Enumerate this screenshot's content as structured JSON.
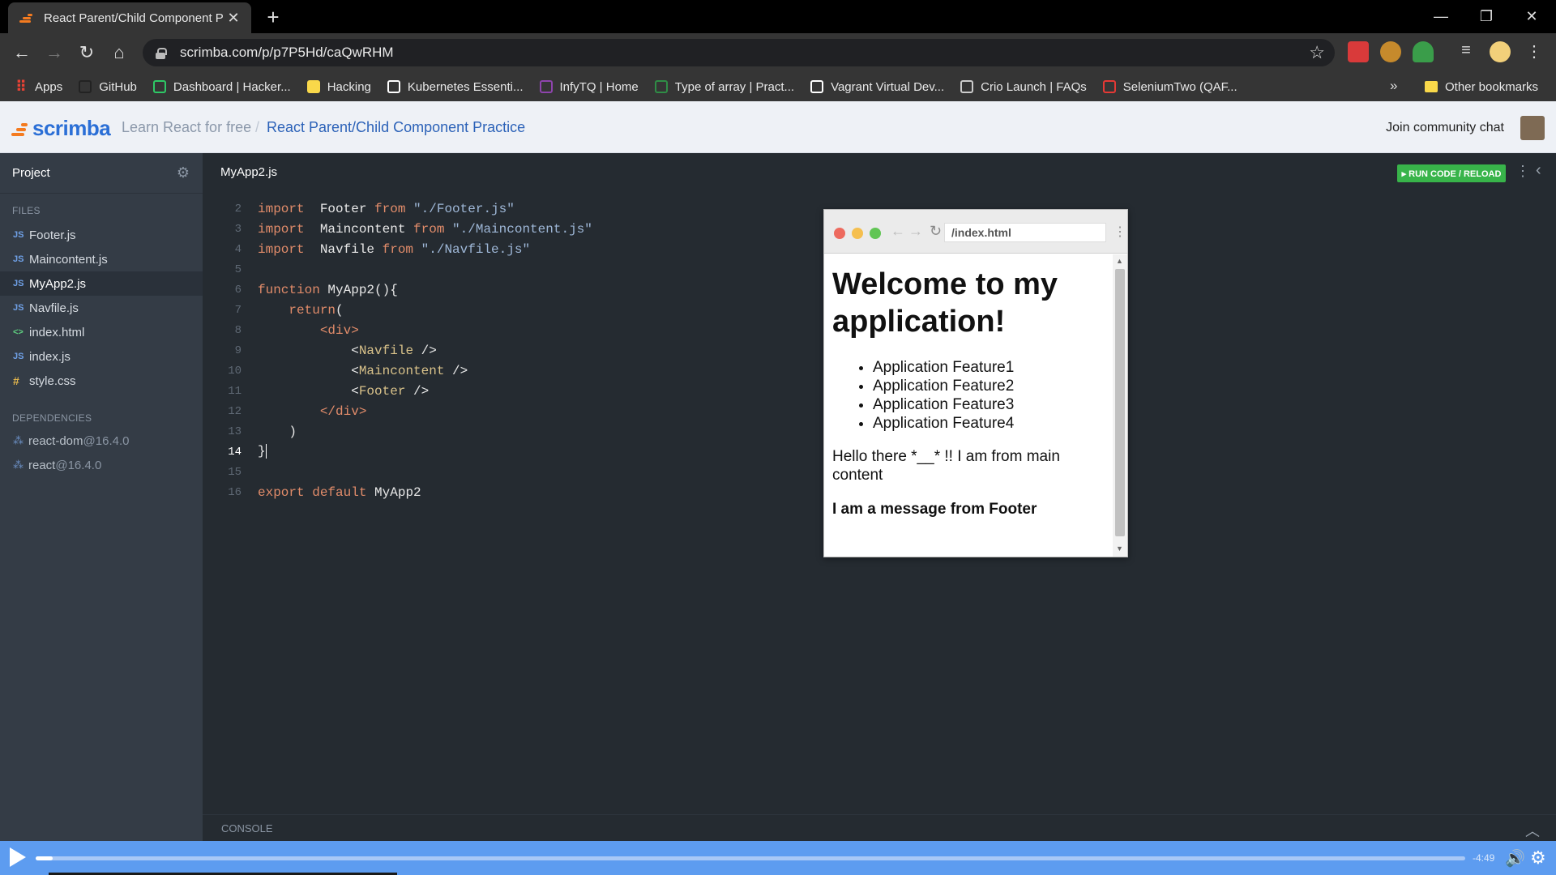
{
  "browser": {
    "tab_title": "React Parent/Child Component P",
    "url": "scrimba.com/p/p7P5Hd/caQwRHM",
    "bookmarks": [
      {
        "label": "Apps",
        "icon": "apps-grid-icon",
        "color": "#e94235"
      },
      {
        "label": "GitHub",
        "icon": "github-icon",
        "color": "#222222"
      },
      {
        "label": "Dashboard | Hacker...",
        "icon": "hackerrank-icon",
        "color": "#2ec866"
      },
      {
        "label": "Hacking",
        "icon": "folder-icon",
        "color": "#f9d84a"
      },
      {
        "label": "Kubernetes Essenti...",
        "icon": "medium-icon",
        "color": "#ffffff"
      },
      {
        "label": "InfyTQ | Home",
        "icon": "infytq-icon",
        "color": "#8e44ad"
      },
      {
        "label": "Type of array | Pract...",
        "icon": "geeksforgeeks-icon",
        "color": "#2f8d46"
      },
      {
        "label": "Vagrant Virtual Dev...",
        "icon": "google-icon",
        "color": "#ffffff"
      },
      {
        "label": "Crio Launch | FAQs",
        "icon": "crio-icon",
        "color": "#cccccc"
      },
      {
        "label": "SeleniumTwo (QAF...",
        "icon": "selenium-icon",
        "color": "#e53935"
      }
    ],
    "more_bookmarks": "»",
    "other_bookmarks": "Other bookmarks"
  },
  "header": {
    "logo": "scrimba",
    "crumb_course": "Learn React for free",
    "crumb_sep": "/",
    "crumb_title": "React Parent/Child Component Practice",
    "join": "Join community chat"
  },
  "sidebar": {
    "project_label": "Project",
    "files_label": "FILES",
    "files": [
      {
        "name": "Footer.js",
        "type": "JS",
        "active": false
      },
      {
        "name": "Maincontent.js",
        "type": "JS",
        "active": false
      },
      {
        "name": "MyApp2.js",
        "type": "JS",
        "active": true
      },
      {
        "name": "Navfile.js",
        "type": "JS",
        "active": false
      },
      {
        "name": "index.html",
        "type": "<>",
        "active": false
      },
      {
        "name": "index.js",
        "type": "JS",
        "active": false
      },
      {
        "name": "style.css",
        "type": "#",
        "active": false
      }
    ],
    "deps_label": "DEPENDENCIES",
    "deps": [
      {
        "name": "react-dom",
        "version": "@16.4.0"
      },
      {
        "name": "react",
        "version": "@16.4.0"
      }
    ]
  },
  "editor": {
    "filename": "MyApp2.js",
    "run_label": "▸ RUN CODE / RELOAD",
    "current_line": 14,
    "lines": [
      {
        "n": "2",
        "tokens": [
          [
            "kw",
            "import"
          ],
          [
            "",
            "  Footer "
          ],
          [
            "kw",
            "from"
          ],
          [
            "str",
            " \"./Footer.js\""
          ]
        ]
      },
      {
        "n": "3",
        "tokens": [
          [
            "kw",
            "import"
          ],
          [
            "",
            "  Maincontent "
          ],
          [
            "kw",
            "from"
          ],
          [
            "str",
            " \"./Maincontent.js\""
          ]
        ]
      },
      {
        "n": "4",
        "tokens": [
          [
            "kw",
            "import"
          ],
          [
            "",
            "  Navfile "
          ],
          [
            "kw",
            "from"
          ],
          [
            "str",
            " \"./Navfile.js\""
          ]
        ]
      },
      {
        "n": "5",
        "tokens": []
      },
      {
        "n": "6",
        "tokens": [
          [
            "kw",
            "function"
          ],
          [
            "",
            " MyApp2(){"
          ]
        ]
      },
      {
        "n": "7",
        "tokens": [
          [
            "",
            "    "
          ],
          [
            "kw",
            "return"
          ],
          [
            "",
            "("
          ]
        ]
      },
      {
        "n": "8",
        "tokens": [
          [
            "",
            "        "
          ],
          [
            "kw",
            "<div>"
          ]
        ]
      },
      {
        "n": "9",
        "tokens": [
          [
            "",
            "            <"
          ],
          [
            "tag",
            "Navfile"
          ],
          [
            "",
            " />"
          ]
        ]
      },
      {
        "n": "10",
        "tokens": [
          [
            "",
            "            <"
          ],
          [
            "tag",
            "Maincontent"
          ],
          [
            "",
            " />"
          ]
        ]
      },
      {
        "n": "11",
        "tokens": [
          [
            "",
            "            <"
          ],
          [
            "tag",
            "Footer"
          ],
          [
            "",
            " />"
          ]
        ]
      },
      {
        "n": "12",
        "tokens": [
          [
            "",
            "        "
          ],
          [
            "kw",
            "</div>"
          ]
        ]
      },
      {
        "n": "13",
        "tokens": [
          [
            "",
            "    )"
          ]
        ]
      },
      {
        "n": "14",
        "tokens": [
          [
            "",
            "}"
          ]
        ]
      },
      {
        "n": "15",
        "tokens": []
      },
      {
        "n": "16",
        "tokens": [
          [
            "kw",
            "export"
          ],
          [
            "",
            " "
          ],
          [
            "kw",
            "default"
          ],
          [
            "",
            " MyApp2"
          ]
        ]
      }
    ]
  },
  "preview": {
    "url": "/index.html",
    "heading": "Welcome to my application!",
    "features": [
      "Application Feature1",
      "Application Feature2",
      "Application Feature3",
      "Application Feature4"
    ],
    "main_text": "Hello there *__* !! I am from main content",
    "footer_text": "I am a message from Footer"
  },
  "console_label": "CONSOLE",
  "player": {
    "time": "-4:49",
    "progress": 0.012
  }
}
